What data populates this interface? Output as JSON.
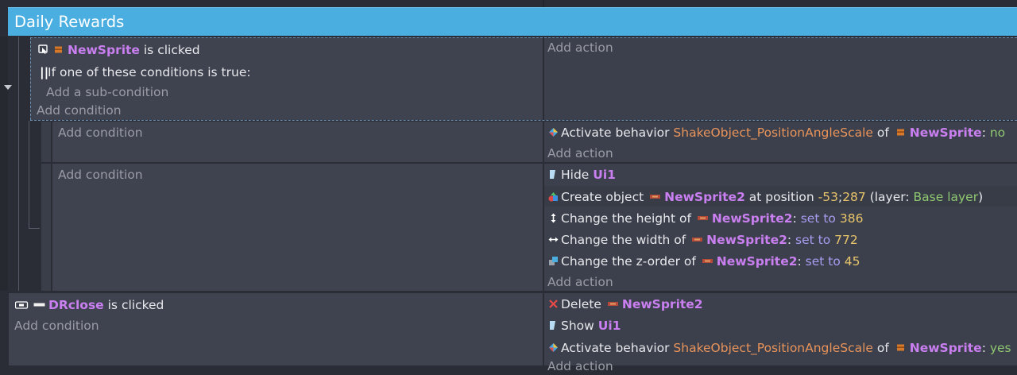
{
  "group": {
    "title": "Daily Rewards"
  },
  "event1": {
    "condition": {
      "object": "NewSprite",
      "text": " is clicked",
      "icon": "mouse-click-icon"
    },
    "or_block": {
      "label": "If one of these conditions is true:",
      "add_sub": "Add a sub-condition"
    },
    "add_condition": "Add condition",
    "add_action": "Add action"
  },
  "sub1": {
    "add_condition": "Add condition",
    "action": {
      "verb": "Activate behavior ",
      "behavior": "ShakeObject_PositionAngleScale",
      "of": " of ",
      "object": "NewSprite",
      "colon": ": ",
      "value": "no"
    },
    "add_action": "Add action"
  },
  "sub2": {
    "add_condition": "Add condition",
    "hide": {
      "verb": "Hide ",
      "object": "Ui1"
    },
    "create": {
      "verb": "Create object ",
      "object": "NewSprite2",
      "at": " at position ",
      "x": "-53",
      "sep": ";",
      "y": "287",
      "layer_open": " (layer: ",
      "layer": "Base layer",
      "layer_close": ")"
    },
    "height": {
      "verb": "Change the height of ",
      "object": "NewSprite2",
      "colon": ": ",
      "op": "set to ",
      "value": "386"
    },
    "width": {
      "verb": "Change the width of ",
      "object": "NewSprite2",
      "colon": ": ",
      "op": "set to ",
      "value": "772"
    },
    "zorder": {
      "verb": "Change the z-order of ",
      "object": "NewSprite2",
      "colon": ": ",
      "op": "set to ",
      "value": "45"
    },
    "add_action": "Add action"
  },
  "event2": {
    "condition": {
      "object": "DRclose",
      "text": " is clicked"
    },
    "add_condition": "Add condition",
    "delete": {
      "verb": "Delete ",
      "object": "NewSprite2"
    },
    "show": {
      "verb": "Show ",
      "object": "Ui1"
    },
    "activate": {
      "verb": "Activate behavior ",
      "behavior": "ShakeObject_PositionAngleScale",
      "of": " of ",
      "object": "NewSprite",
      "colon": ": ",
      "value": "yes"
    },
    "add_action": "Add action"
  },
  "colors": {
    "header": "#4aaee0",
    "object": "#c97ff0",
    "behavior": "#e8935a",
    "number": "#e8c56a",
    "boolean": "#8fc870",
    "operator": "#a69cf0"
  }
}
